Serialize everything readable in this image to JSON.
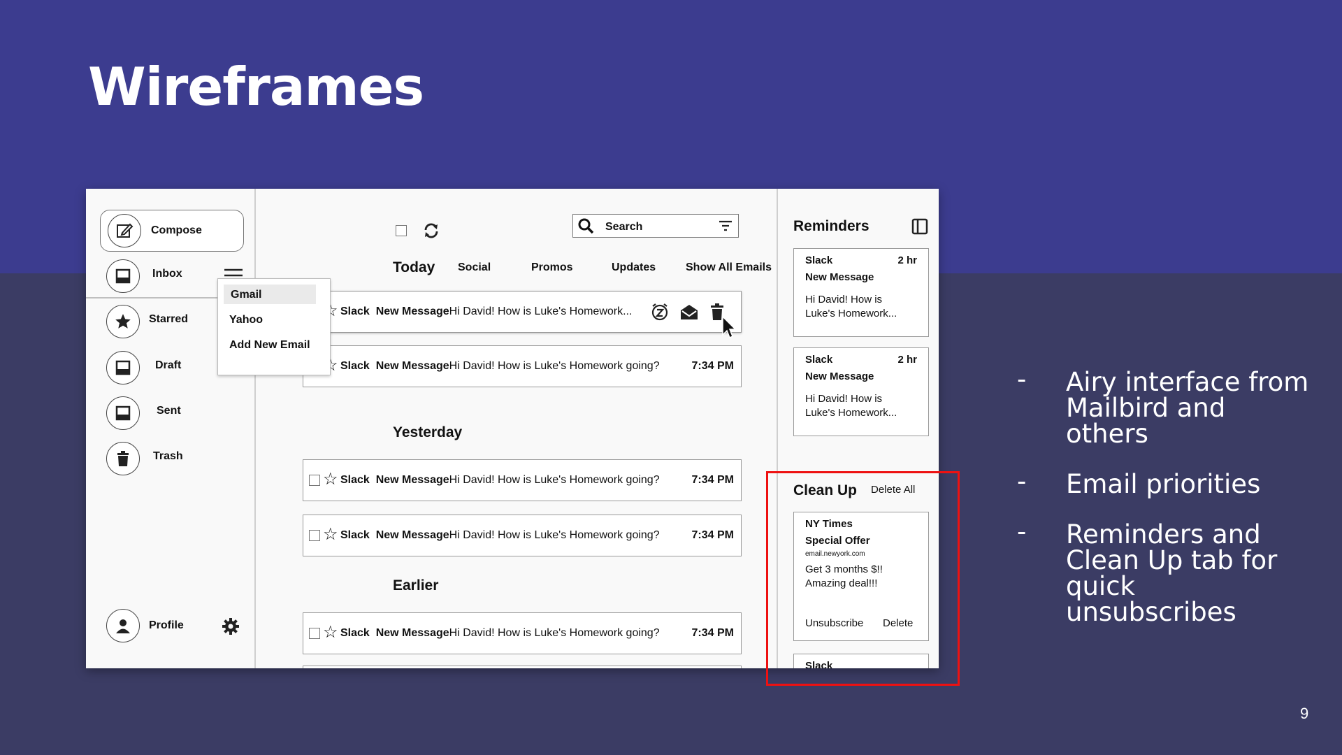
{
  "slide": {
    "title": "Wireframes",
    "page_number": "9",
    "bullets": [
      "Airy interface from Mailbird and others",
      "Email priorities",
      "Reminders and Clean Up tab for quick unsubscribes"
    ],
    "bullet_marker": "-",
    "highlight_color": "#e11111",
    "top_band_color": "#3c3c8f",
    "bottom_band_color": "#3b3c64"
  },
  "sidebar": {
    "compose": "Compose",
    "inbox": "Inbox",
    "starred": "Starred",
    "draft": "Draft",
    "sent": "Sent",
    "trash": "Trash",
    "profile": "Profile",
    "accounts_menu": [
      "Gmail",
      "Yahoo",
      "Add New Email"
    ]
  },
  "toolbar": {
    "search_placeholder": "Search"
  },
  "tabs": [
    "Today",
    "Social",
    "Promos",
    "Updates",
    "Show All Emails"
  ],
  "sections": {
    "yesterday": "Yesterday",
    "earlier": "Earlier"
  },
  "emails": {
    "today": [
      {
        "sender": "Slack",
        "subject": "New Message",
        "preview": "Hi David! How is Luke's Homework...",
        "time": ""
      },
      {
        "sender": "Slack",
        "subject": "New Message",
        "preview": "Hi David! How is Luke's Homework going?",
        "time": "7:34 PM"
      }
    ],
    "yesterday": [
      {
        "sender": "Slack",
        "subject": "New Message",
        "preview": "Hi David! How is Luke's Homework going?",
        "time": "7:34 PM"
      },
      {
        "sender": "Slack",
        "subject": "New Message",
        "preview": "Hi David! How is Luke's Homework going?",
        "time": "7:34 PM"
      }
    ],
    "earlier": [
      {
        "sender": "Slack",
        "subject": "New Message",
        "preview": "Hi David! How is Luke's Homework going?",
        "time": "7:34 PM"
      }
    ]
  },
  "reminders": {
    "title": "Reminders",
    "cards": [
      {
        "sender": "Slack",
        "age": "2 hr",
        "subject": "New Message",
        "line1": "Hi David! How is",
        "line2": "Luke's Homework..."
      },
      {
        "sender": "Slack",
        "age": "2 hr",
        "subject": "New Message",
        "line1": "Hi David! How is",
        "line2": "Luke's Homework..."
      }
    ]
  },
  "cleanup": {
    "title": "Clean Up",
    "delete_all": "Delete All",
    "cards": [
      {
        "sender": "NY Times",
        "subject": "Special Offer",
        "email": "email.newyork.com",
        "line1": "Get 3 months $!!",
        "line2": "Amazing deal!!!",
        "unsubscribe": "Unsubscribe",
        "delete": "Delete"
      },
      {
        "sender": "Slack"
      }
    ]
  }
}
